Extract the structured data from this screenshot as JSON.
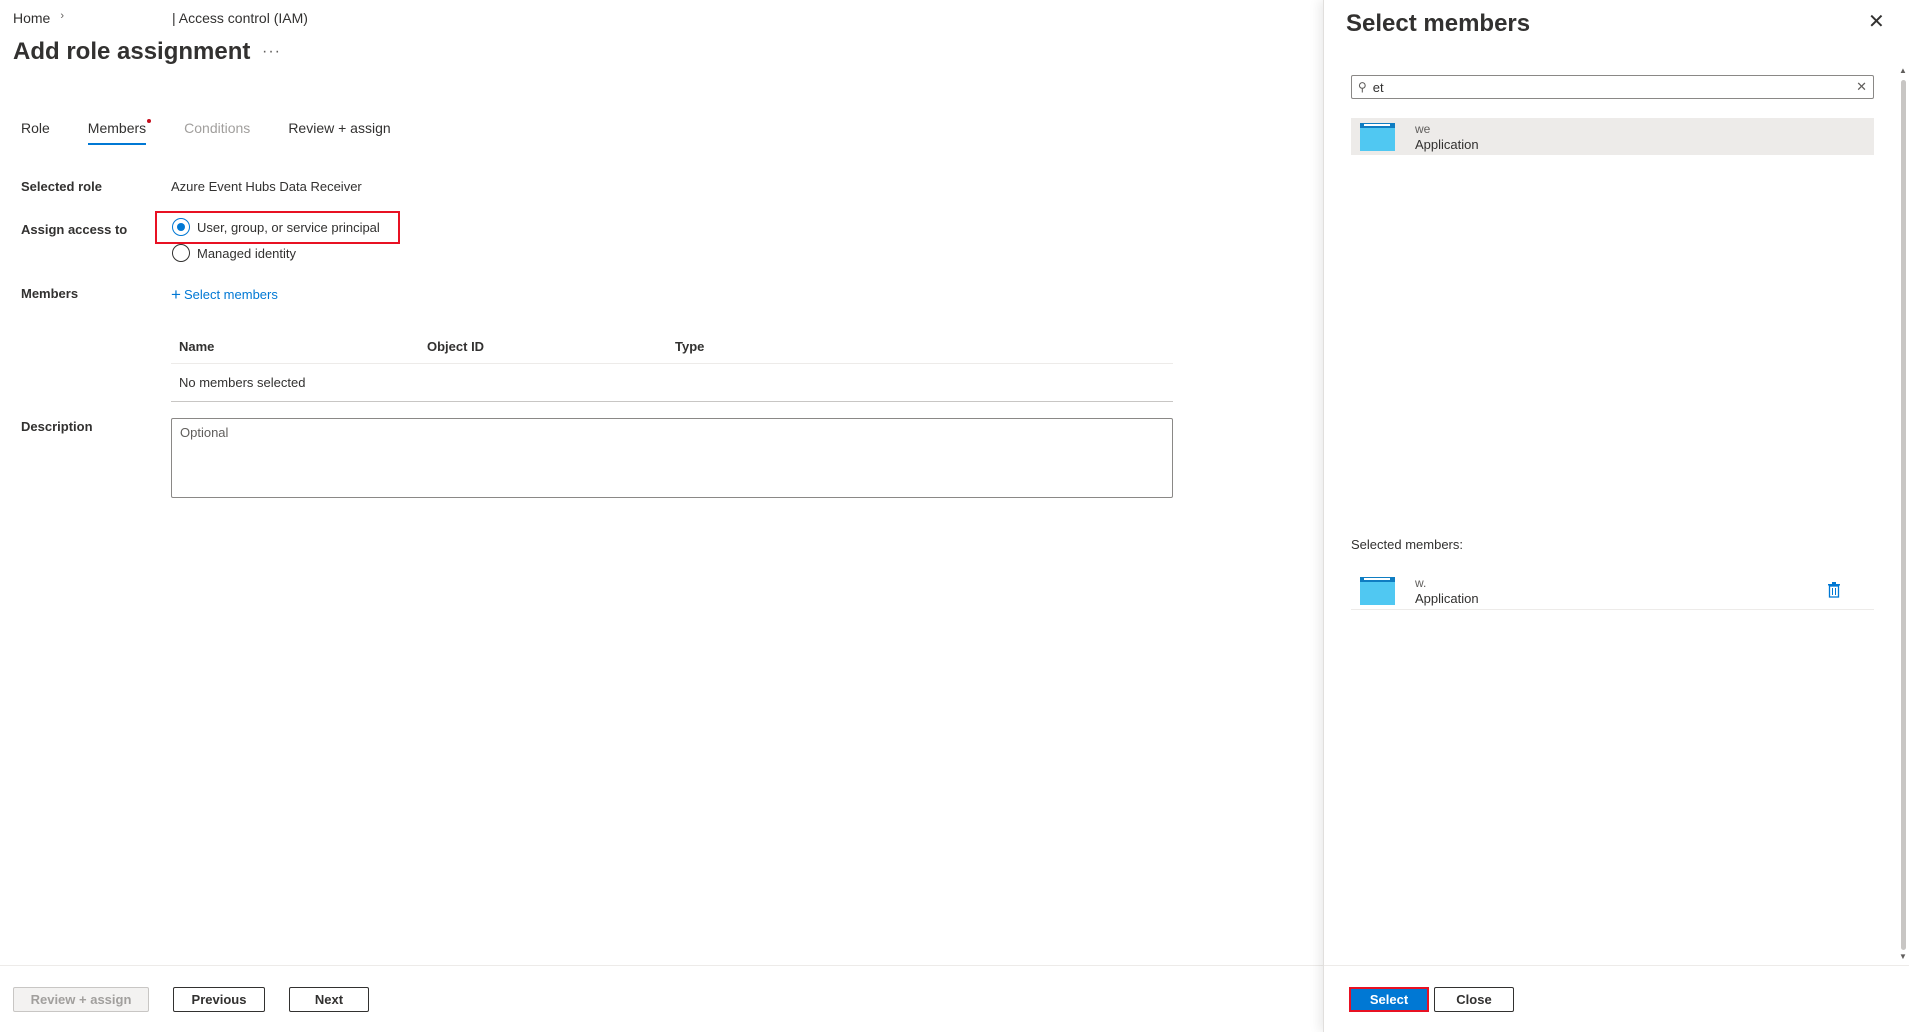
{
  "breadcrumb": {
    "home": "Home",
    "separator": "›",
    "current": "| Access control (IAM)"
  },
  "page": {
    "title": "Add role assignment",
    "more": "···"
  },
  "tabs": [
    {
      "label": "Role"
    },
    {
      "label": "Members"
    },
    {
      "label": "Conditions"
    },
    {
      "label": "Review + assign"
    }
  ],
  "form": {
    "selected_role_label": "Selected role",
    "selected_role_value": "Azure Event Hubs Data Receiver",
    "assign_access_label": "Assign access to",
    "assign_options": [
      {
        "label": "User, group, or service principal",
        "checked": true
      },
      {
        "label": "Managed identity",
        "checked": false
      }
    ],
    "members_label": "Members",
    "select_members_link": "Select members",
    "table": {
      "headers": [
        "Name",
        "Object ID",
        "Type"
      ],
      "empty_text": "No members selected"
    },
    "description_label": "Description",
    "description_placeholder": "Optional"
  },
  "footer": {
    "review_assign": "Review + assign",
    "previous": "Previous",
    "next": "Next"
  },
  "panel": {
    "title": "Select members",
    "search_value": "et",
    "results": [
      {
        "name": "we",
        "type": "Application"
      }
    ],
    "selected_label": "Selected members:",
    "selected": [
      {
        "name": "w.",
        "type": "Application"
      }
    ],
    "select_button": "Select",
    "close_button": "Close"
  },
  "colors": {
    "accent": "#0078d4",
    "highlight": "#e81123",
    "app_icon": "#50c8f2"
  }
}
